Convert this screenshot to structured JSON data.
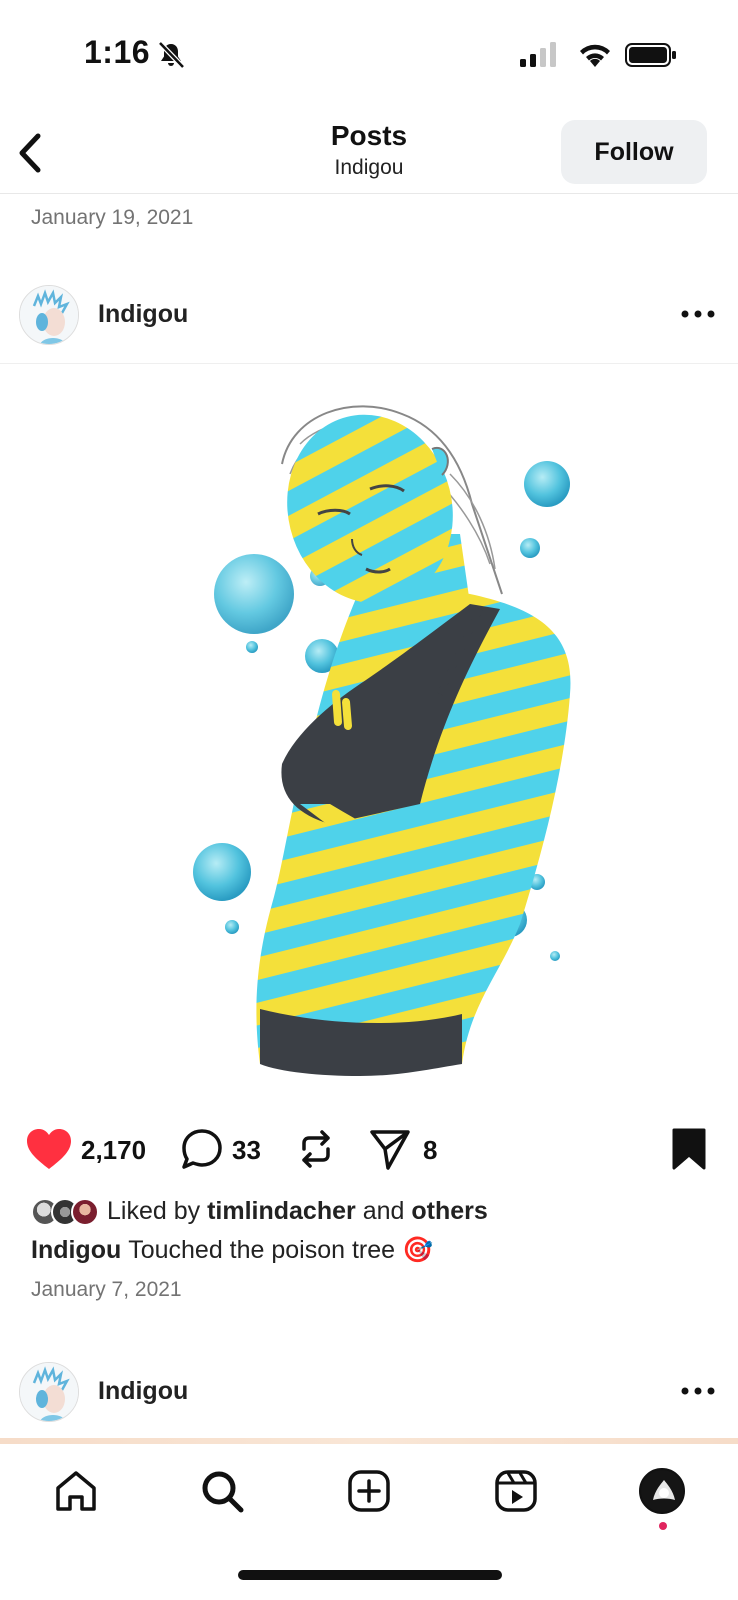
{
  "status_bar": {
    "time": "1:16"
  },
  "header": {
    "title": "Posts",
    "subtitle": "Indigou",
    "follow_label": "Follow"
  },
  "previous_post": {
    "date": "January 19, 2021"
  },
  "post": {
    "username": "Indigou",
    "likes": "2,170",
    "comments": "33",
    "shares": "8",
    "liked_by_prefix": "Liked by",
    "liked_by_user": "timlindacher",
    "liked_by_joiner": "and",
    "liked_by_suffix": "others",
    "caption_user": "Indigou",
    "caption_text": "Touched the poison tree 🎯",
    "date": "January 7, 2021",
    "icons": [
      "heart-filled-icon",
      "comment-icon",
      "repost-icon",
      "send-icon",
      "bookmark-filled-icon"
    ]
  },
  "next_post": {
    "username": "Indigou"
  },
  "tab_bar": {
    "icons": [
      "home-icon",
      "search-icon",
      "create-icon",
      "reels-icon",
      "profile-avatar"
    ]
  },
  "colors": {
    "like_red": "#ff3040",
    "stripe_yellow": "#f4e03a",
    "stripe_cyan": "#4fd2ea",
    "top_black": "#3b3f45",
    "muted_text": "#737373"
  }
}
